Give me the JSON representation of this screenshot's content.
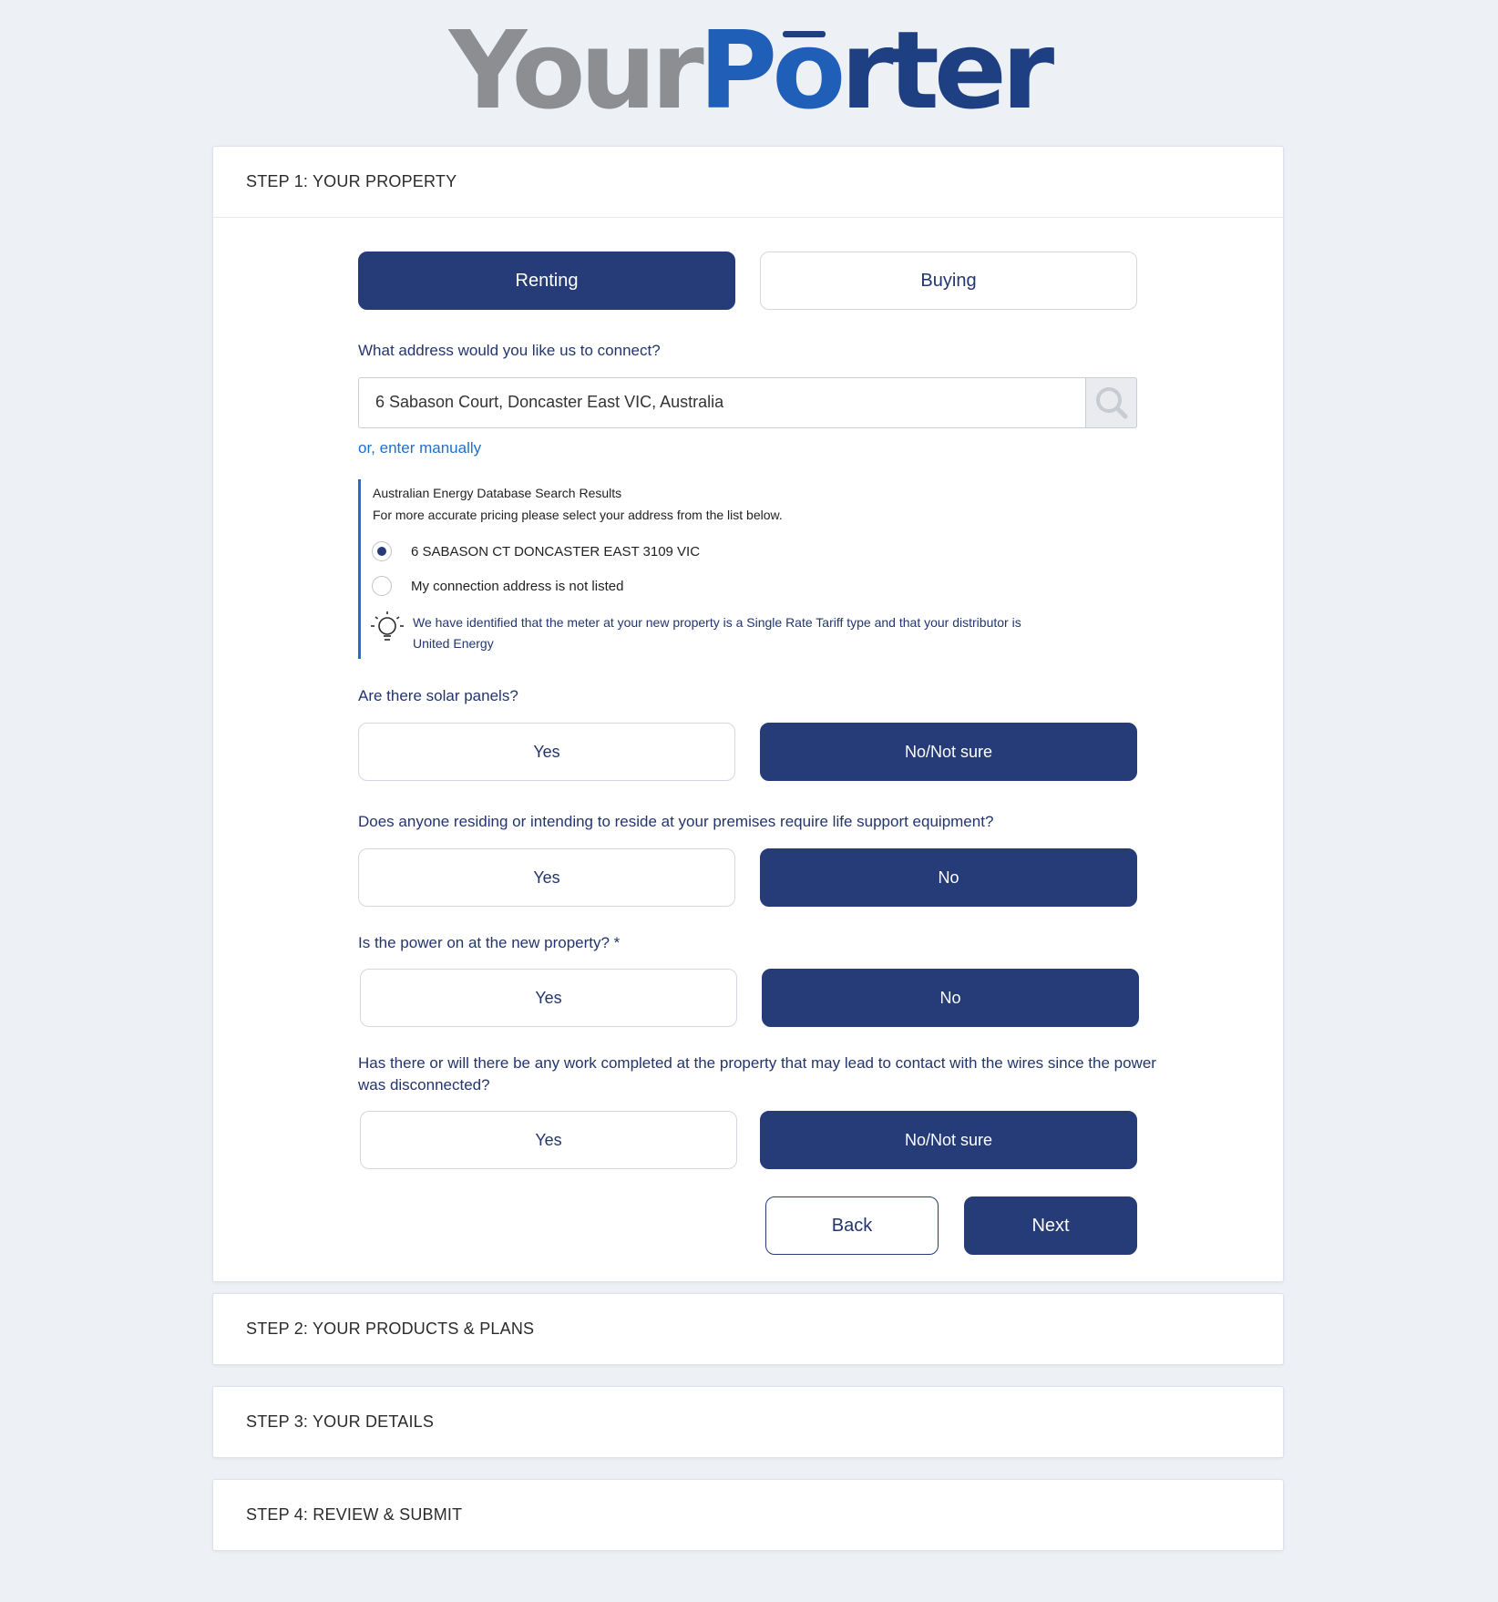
{
  "brand": {
    "logo_part1": "Your",
    "logo_part2_o_prefix": "P",
    "logo_part2_o": "o",
    "logo_part2_rest": "rter"
  },
  "steps": {
    "step1": "STEP 1: YOUR PROPERTY",
    "step2": "STEP 2: YOUR PRODUCTS & PLANS",
    "step3": "STEP 3: YOUR DETAILS",
    "step4": "STEP 4: REVIEW & SUBMIT"
  },
  "tenure": {
    "renting": "Renting",
    "buying": "Buying",
    "selected": "Renting"
  },
  "address": {
    "question": "What address would you like us to connect?",
    "value": "6 Sabason Court, Doncaster East VIC, Australia",
    "enter_manually": "or, enter manually"
  },
  "results": {
    "heading": "Australian Energy Database Search Results",
    "subheading": "For more accurate pricing please select your address from the list below.",
    "options": [
      {
        "label": "6 SABASON CT DONCASTER EAST 3109 VIC",
        "selected": true
      },
      {
        "label": "My connection address is not listed",
        "selected": false
      }
    ],
    "tip": "We have identified that the meter at your new property is a Single Rate Tariff type and that your distributor is United Energy"
  },
  "questions": {
    "solar": {
      "label": "Are there solar panels?",
      "yes": "Yes",
      "no": "No/Not sure",
      "selected": "No/Not sure"
    },
    "life_support": {
      "label": "Does anyone residing or intending to reside at your premises require life support equipment?",
      "yes": "Yes",
      "no": "No",
      "selected": "No"
    },
    "power_on": {
      "label": "Is the power on at the new property? *",
      "yes": "Yes",
      "no": "No",
      "selected": "No"
    },
    "wires": {
      "label": "Has there or will there be any work completed at the property that may lead to contact with the wires since the power was disconnected?",
      "yes": "Yes",
      "no": "No/Not sure",
      "selected": "No/Not sure"
    }
  },
  "nav": {
    "back": "Back",
    "next": "Next"
  },
  "colors": {
    "primary": "#263c78",
    "link": "#1f6fd1",
    "background": "#edf1f5"
  }
}
